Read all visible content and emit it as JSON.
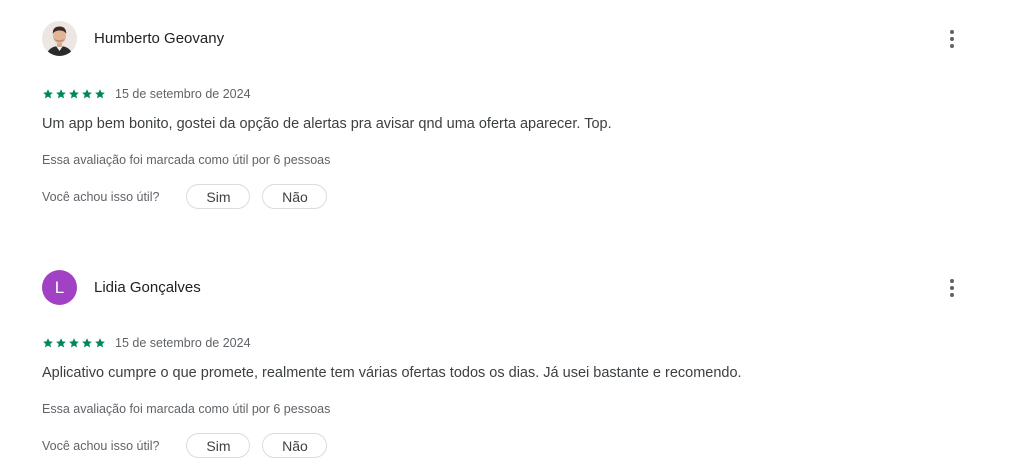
{
  "reviews": [
    {
      "author": "Humberto Geovany",
      "avatar_type": "photo",
      "rating": 5,
      "date": "15 de setembro de 2024",
      "text": "Um app bem bonito, gostei da opção de alertas pra avisar qnd uma oferta aparecer. Top.",
      "helpful_count_text": "Essa avaliação foi marcada como útil por 6 pessoas",
      "helpful_question": "Você achou isso útil?",
      "yes_label": "Sim",
      "no_label": "Não"
    },
    {
      "author": "Lidia Gonçalves",
      "avatar_type": "letter",
      "avatar_letter": "L",
      "avatar_color": "#a142c4",
      "rating": 5,
      "date": "15 de setembro de 2024",
      "text": "Aplicativo cumpre o que promete, realmente tem várias ofertas todos os dias. Já usei bastante e recomendo.",
      "helpful_count_text": "Essa avaliação foi marcada como útil por 6 pessoas",
      "helpful_question": "Você achou isso útil?",
      "yes_label": "Sim",
      "no_label": "Não"
    }
  ],
  "colors": {
    "star": "#01875f",
    "more_icon": "#5f6368",
    "text_primary": "#202124",
    "text_secondary": "#5f6368"
  },
  "icons": {
    "more": "more-vert-icon",
    "star": "star-icon"
  }
}
